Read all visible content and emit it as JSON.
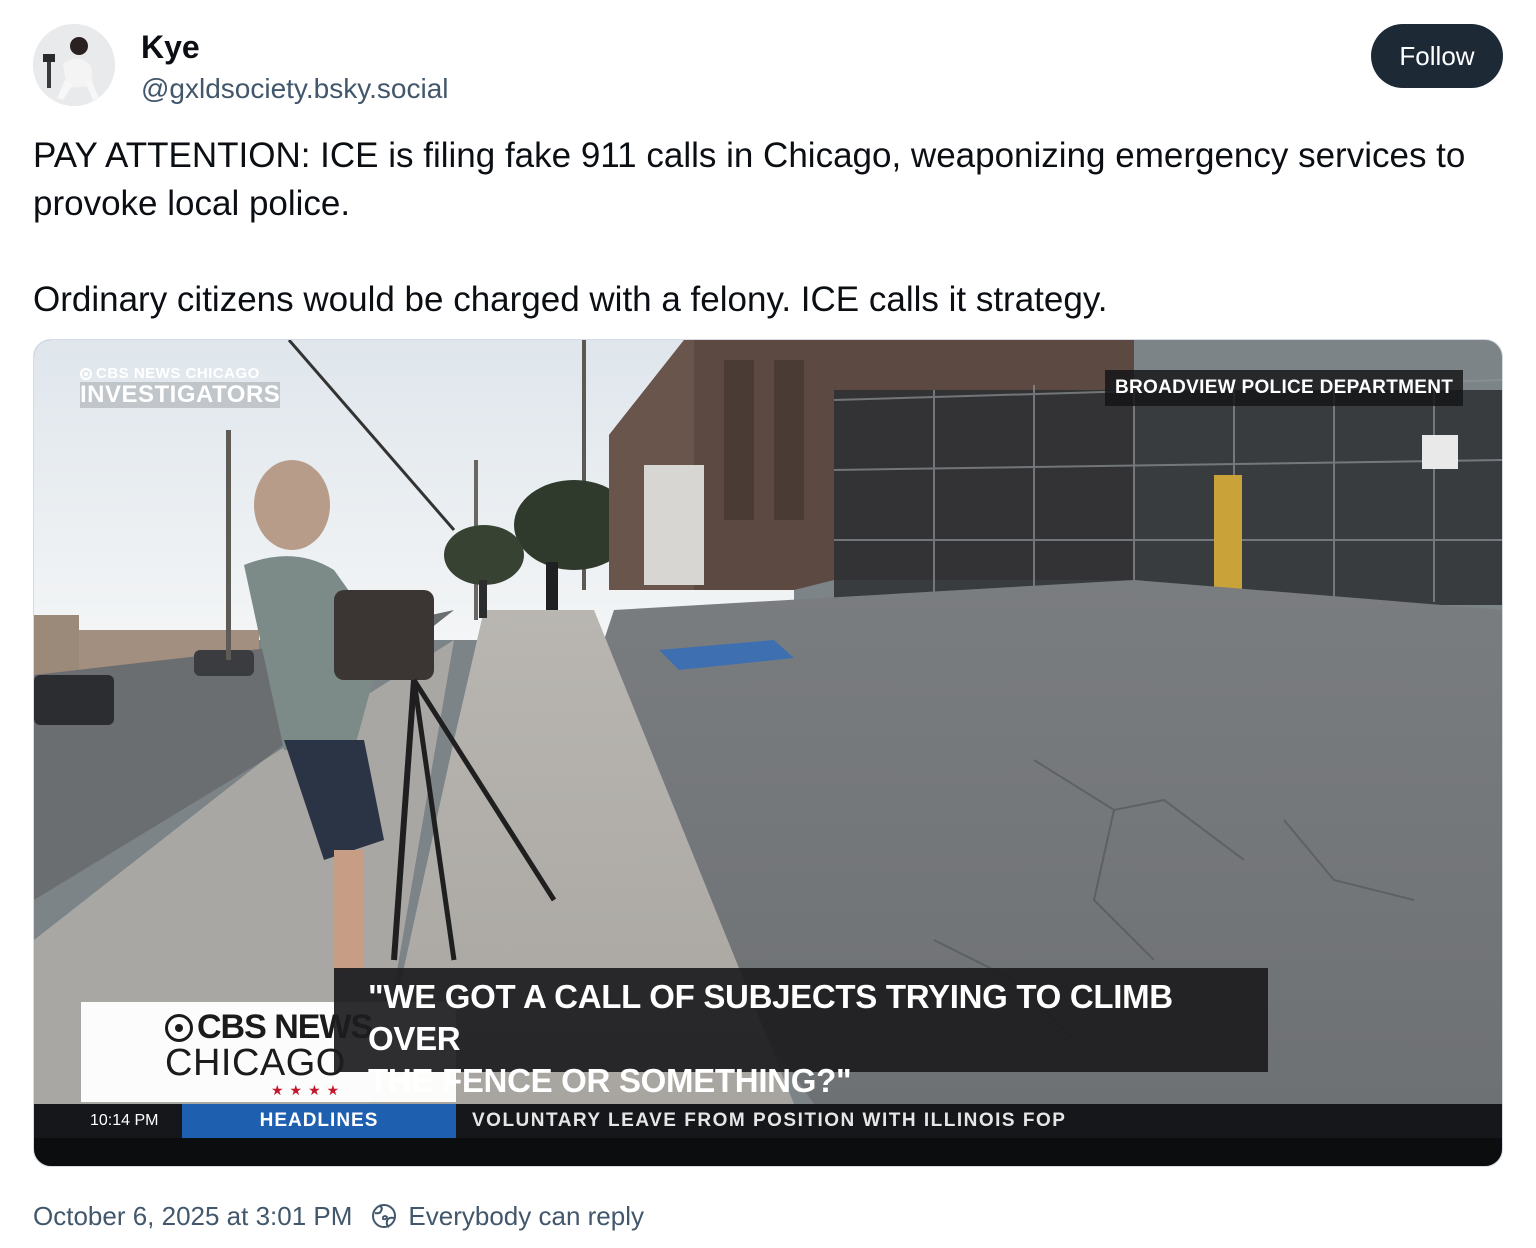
{
  "author": {
    "display_name": "Kye",
    "handle": "@gxldsociety.bsky.social",
    "avatar_icon": "avatar-photo"
  },
  "follow_label": "Follow",
  "post": {
    "paragraph_1": "PAY ATTENTION: ICE is filing fake 911 calls in Chicago, weaponizing emergency services to provoke local police.",
    "paragraph_2": "Ordinary citizens would be charged with a felony. ICE calls it strategy."
  },
  "video": {
    "investigators_top": "CBS NEWS CHICAGO",
    "investigators_label": "INVESTIGATORS",
    "department_tag": "BROADVIEW POLICE DEPARTMENT",
    "caption_line_1": "\"WE GOT A CALL OF SUBJECTS TRYING TO CLIMB OVER",
    "caption_line_2": "THE FENCE OR SOMETHING?\"",
    "cbs_line_1": "CBS NEWS",
    "cbs_line_2": "CHICAGO",
    "cbs_stars": "★★★★",
    "ticker_time": "10:14 PM",
    "ticker_section": "HEADLINES",
    "ticker_text": "VOLUNTARY LEAVE FROM POSITION WITH ILLINOIS FOP"
  },
  "footer": {
    "timestamp": "October 6, 2025 at 3:01 PM",
    "reply_setting": "Everybody can reply",
    "reply_icon": "globe-reply-icon"
  },
  "colors": {
    "follow_button_bg": "#1e2936",
    "muted_text": "#42576c",
    "headlines_blue": "#1f5fb0",
    "cbs_star_red": "#c2182b"
  }
}
